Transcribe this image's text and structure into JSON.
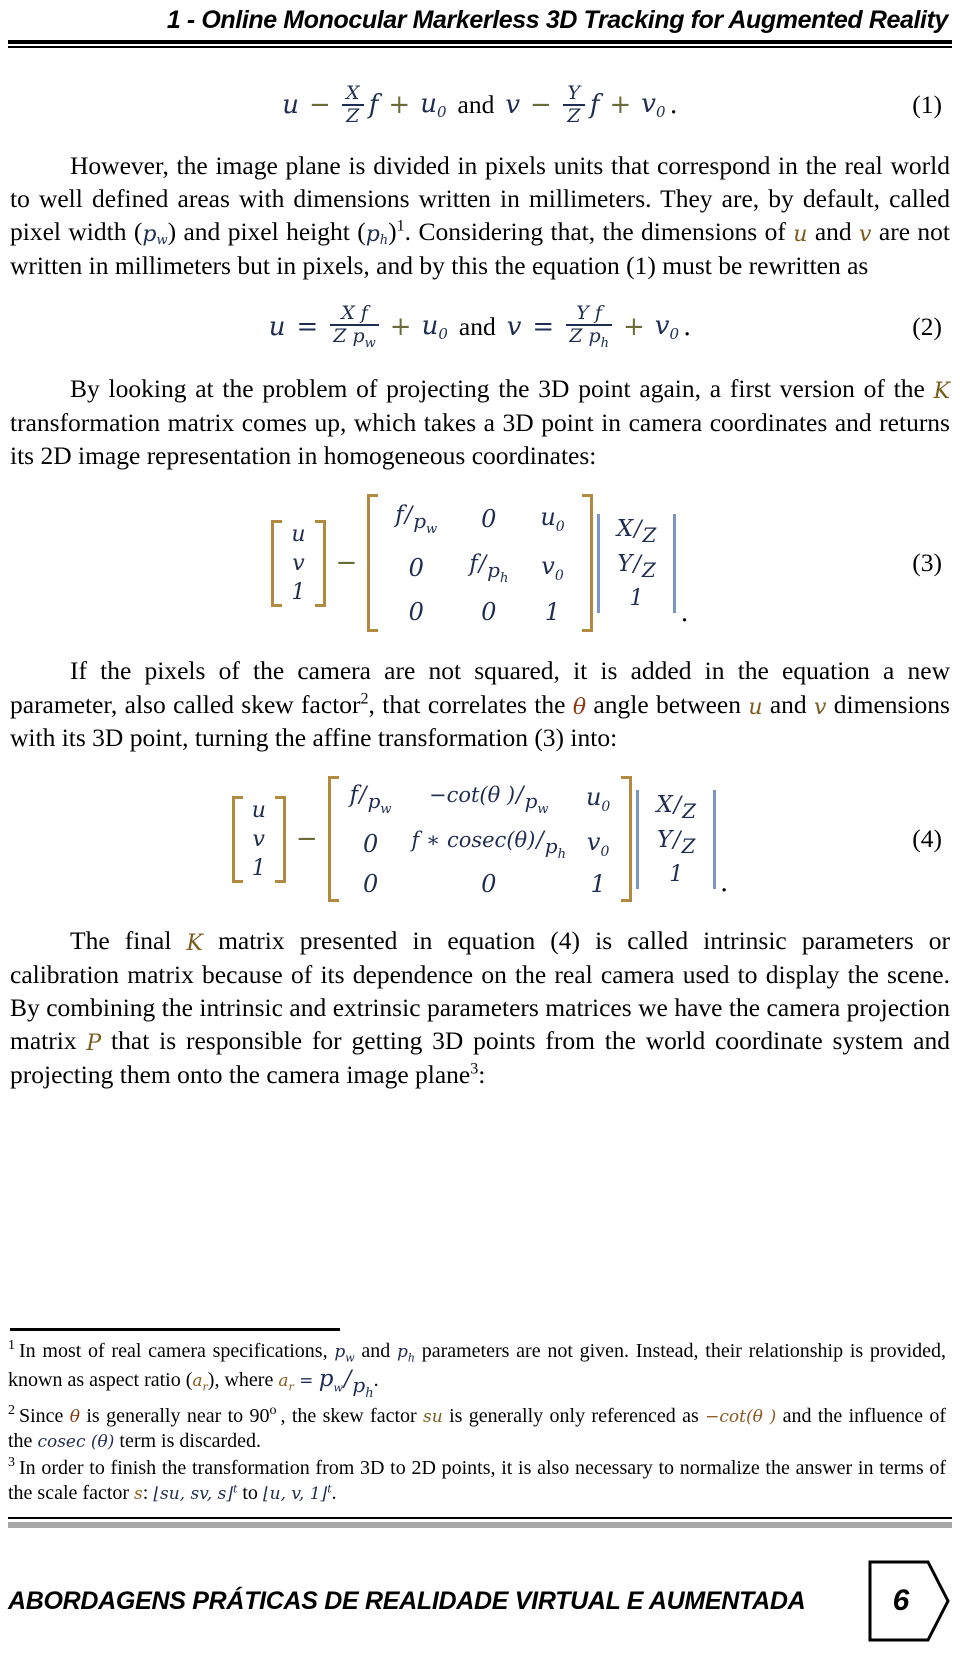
{
  "header": {
    "running_head": "1 - Online Monocular Markerless 3D Tracking for Augmented Reality"
  },
  "equations": {
    "eq1": {
      "number": "(1)",
      "lhs1": "u",
      "minus": "−",
      "num1": "X",
      "den1": "Z",
      "f": "f",
      "plus": "+",
      "sub1": "u",
      "zero1": "0",
      "and": "and",
      "lhs2": "v",
      "num2": "Y",
      "den2": "Z",
      "sub2": "v",
      "zero2": "0",
      "period": "."
    },
    "eq2": {
      "number": "(2)",
      "lhs1": "u",
      "eq": "=",
      "num1": "X f",
      "den1": "Z p",
      "den1sub": "w",
      "plus": "+",
      "sub1": "u",
      "zero1": "0",
      "and": "and",
      "lhs2": "v",
      "num2": "Y f",
      "den2": "Z p",
      "den2sub": "h",
      "sub2": "v",
      "zero2": "0",
      "period": "."
    },
    "eq3": {
      "number": "(3)",
      "lhs": [
        "u",
        "v",
        "1"
      ],
      "op": "−",
      "matrix": [
        [
          "f/p_w",
          "0",
          "u_0"
        ],
        [
          "0",
          "f/p_h",
          "v_0"
        ],
        [
          "0",
          "0",
          "1"
        ]
      ],
      "matrix_cells": {
        "r0c0_a": "f",
        "r0c0_b": "p",
        "r0c0_bsub": "w",
        "r0c1": "0",
        "r0c2": "u",
        "r0c2sub": "0",
        "r1c0": "0",
        "r1c1_a": "f",
        "r1c1_b": "p",
        "r1c1_bsub": "h",
        "r1c2": "v",
        "r1c2sub": "0",
        "r2c0": "0",
        "r2c1": "0",
        "r2c2": "1"
      },
      "vector": [
        {
          "a": "X",
          "b": "Z"
        },
        {
          "a": "Y",
          "b": "Z"
        },
        {
          "a": "1",
          "b": ""
        }
      ],
      "period": "."
    },
    "eq4": {
      "number": "(4)",
      "lhs": [
        "u",
        "v",
        "1"
      ],
      "op": "−",
      "matrix_cells": {
        "r0c0_a": "f",
        "r0c0_b": "p",
        "r0c0_bsub": "w",
        "r0c1_a": "−cot(θ )",
        "r0c1_b": "p",
        "r0c1_bsub": "w",
        "r0c2": "u",
        "r0c2sub": "0",
        "r1c0": "0",
        "r1c1_a": "f ∗ cosec(θ)",
        "r1c1_b": "p",
        "r1c1_bsub": "h",
        "r1c2": "v",
        "r1c2sub": "0",
        "r2c0": "0",
        "r2c1": "0",
        "r2c2": "1"
      },
      "vector": [
        {
          "a": "X",
          "b": "Z"
        },
        {
          "a": "Y",
          "b": "Z"
        },
        {
          "a": "1",
          "b": ""
        }
      ],
      "period": "."
    }
  },
  "paragraphs": {
    "p1_a": "However, the image plane is divided in pixels units that correspond in the real world to well defined areas with dimensions written in millimeters. They are, by default, called pixel width (",
    "p1_pw": "p",
    "p1_pw_sub": "w",
    "p1_b": ") and pixel height (",
    "p1_ph": "p",
    "p1_ph_sub": "h",
    "p1_c": ")",
    "p1_fn": "1",
    "p1_d": ". Considering that, the dimensions of ",
    "p1_u": "u",
    "p1_e": " and ",
    "p1_v": "v",
    "p1_f": " are not written in millimeters but in pixels, and by this the equation (1) must be rewritten as",
    "p2_a": "By looking at the problem of projecting the 3D point again, a first version of the ",
    "p2_K": "K",
    "p2_b": " transformation matrix comes up, which takes a 3D point in camera coordinates and returns its 2D image representation in homogeneous coordinates:",
    "p3_a": "If the pixels of the camera are not squared, it is added in the equation a new parameter, also called skew factor",
    "p3_fn": "2",
    "p3_b": ", that correlates the ",
    "p3_theta": "θ",
    "p3_c": " angle between ",
    "p3_u": "u",
    "p3_d": " and ",
    "p3_v": "v",
    "p3_e": " dimensions with its 3D point, turning the affine transformation (3) into:",
    "p4_a": "The final ",
    "p4_K": "K",
    "p4_b": " matrix presented in equation (4) is called intrinsic parameters or calibration matrix because of its dependence on the real camera used to display the scene. By combining the intrinsic and extrinsic parameters matrices we have the camera projection matrix ",
    "p4_P": "P",
    "p4_c": " that is responsible for getting 3D points from the world coordinate system and projecting them onto the camera image plane",
    "p4_fn": "3",
    "p4_d": ":"
  },
  "footnotes": [
    {
      "mark": "1",
      "a": "In most of real camera specifications, ",
      "sym1": "p",
      "sym1sub": "w",
      "b": " and ",
      "sym2": "p",
      "sym2sub": "h",
      "c": " parameters are not given. Instead, their relationship is provided, known as aspect ratio (",
      "sym3": "a",
      "sym3sub": "r",
      "d": "), where ",
      "sym4": "a",
      "sym4sub": "r",
      "e": " = ",
      "fnum": "p",
      "fnumsub": "w",
      "fden": "p",
      "fdensub": "h",
      "f": "."
    },
    {
      "mark": "2",
      "a": "Since ",
      "sym1": "θ",
      "b": " is generally near to 90",
      "deg": "o",
      "c": ", the skew factor ",
      "sym2": "su",
      "d": " is generally only referenced as ",
      "sym3": "−cot(θ )",
      "e": " and the influence of the ",
      "sym4": "cosec (θ)",
      "f": " term is discarded."
    },
    {
      "mark": "3",
      "a": "In order to finish the transformation from 3D to 2D points, it is also necessary to normalize the answer in terms of the scale factor ",
      "sym1": "s",
      "b": ": ",
      "vec1": "su, sv, s",
      "vec1sup": "t",
      "c": " to ",
      "vec2": "u, v, 1",
      "vec2sup": "t",
      "d": "."
    }
  ],
  "footer": {
    "title": "Abordagens Práticas de Realidade Virtual e Aumentada",
    "page_number": "6"
  },
  "colors": {
    "math_blue": "#1f2d52",
    "bracket_tan": "#b08a3e",
    "bracket_blue": "#7a96c4",
    "footer_grey": "#a8a8a8"
  }
}
